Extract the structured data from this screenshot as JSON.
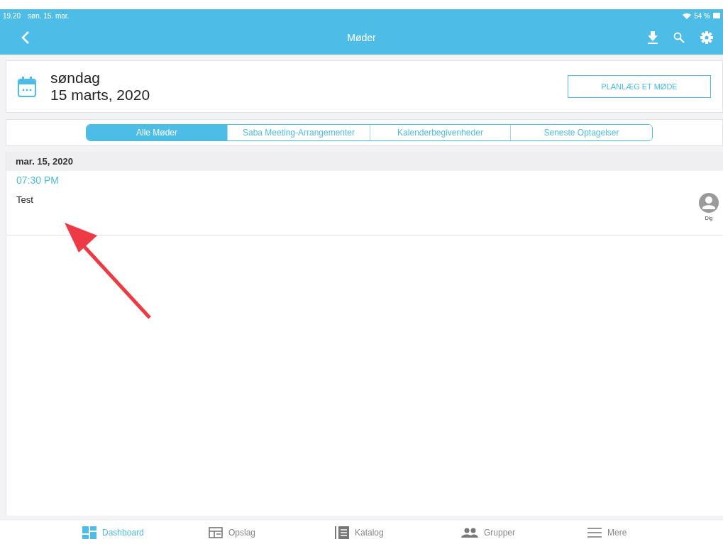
{
  "status_bar": {
    "time": "19.20",
    "date": "søn. 15. mar.",
    "battery": "54 %"
  },
  "nav_bar": {
    "title": "Møder"
  },
  "header": {
    "weekday": "søndag",
    "date": "15 marts, 2020",
    "action": "PLANLÆG ET MØDE"
  },
  "tabs": [
    {
      "label": "Alle Møder",
      "selected": true
    },
    {
      "label": "Saba Meeting-Arrangementer",
      "selected": false
    },
    {
      "label": "Kalenderbegivenheder",
      "selected": false
    },
    {
      "label": "Seneste Optagelser",
      "selected": false
    }
  ],
  "sections": [
    {
      "date": "mar. 15, 2020",
      "meetings": [
        {
          "time": "07:30 PM",
          "title": "Test",
          "host": "Dig"
        }
      ]
    }
  ],
  "bottom_tabs": [
    {
      "label": "Dashboard",
      "kind": "dashboard",
      "selected": true
    },
    {
      "label": "Opslag",
      "kind": "board",
      "selected": false
    },
    {
      "label": "Katalog",
      "kind": "catalog",
      "selected": false
    },
    {
      "label": "Grupper",
      "kind": "groups",
      "selected": false
    },
    {
      "label": "Mere",
      "kind": "more",
      "selected": false
    }
  ]
}
